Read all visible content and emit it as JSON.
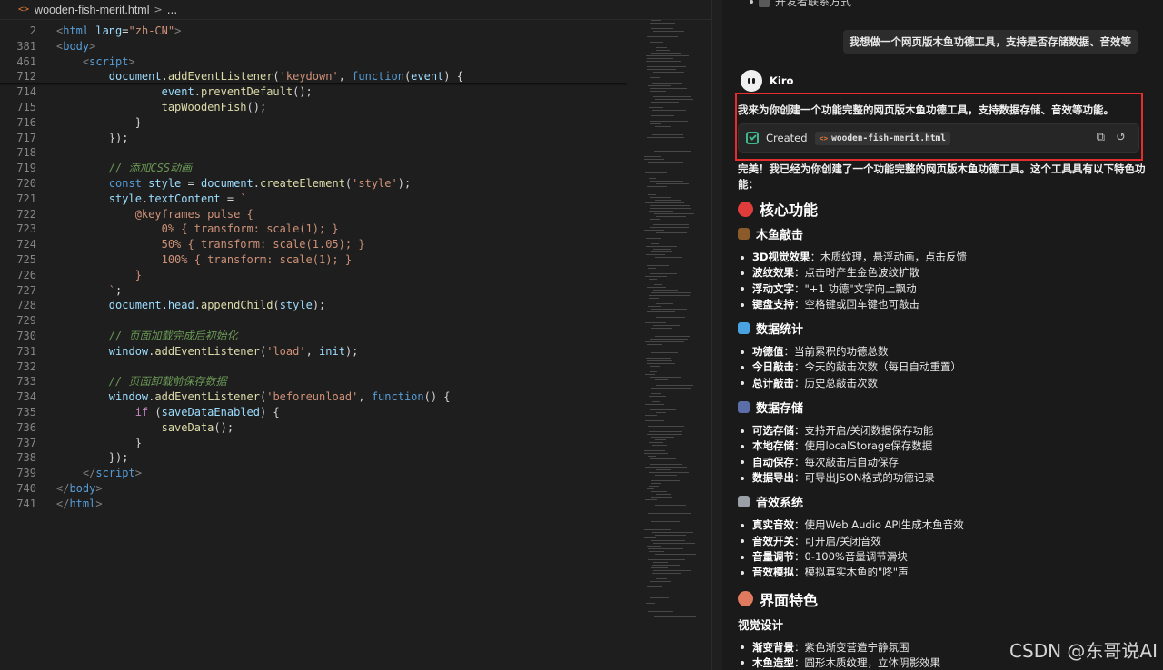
{
  "editor": {
    "breadcrumb": {
      "file": "wooden-fish-merit.html",
      "separator": ">",
      "more": "..."
    },
    "lines": [
      {
        "n": "2",
        "tokens": [
          [
            "brk",
            "<"
          ],
          [
            "tag",
            "html"
          ],
          [
            "pun",
            " "
          ],
          [
            "attr",
            "lang"
          ],
          [
            "pun",
            "="
          ],
          [
            "str",
            "\"zh-CN\""
          ],
          [
            "brk",
            ">"
          ]
        ]
      },
      {
        "n": "381",
        "tokens": [
          [
            "brk",
            "<"
          ],
          [
            "tag",
            "body"
          ],
          [
            "brk",
            ">"
          ]
        ]
      },
      {
        "n": "461",
        "tokens": [
          [
            "pun",
            "    "
          ],
          [
            "brk",
            "<"
          ],
          [
            "tag",
            "script"
          ],
          [
            "brk",
            ">"
          ]
        ]
      },
      {
        "n": "712",
        "tokens": [
          [
            "pun",
            "        "
          ],
          [
            "var",
            "document"
          ],
          [
            "pun",
            "."
          ],
          [
            "fn",
            "addEventListener"
          ],
          [
            "pun",
            "("
          ],
          [
            "str",
            "'keydown'"
          ],
          [
            "pun",
            ", "
          ],
          [
            "kw",
            "function"
          ],
          [
            "pun",
            "("
          ],
          [
            "var",
            "event"
          ],
          [
            "pun",
            ") {"
          ]
        ]
      },
      {
        "n": "714",
        "tokens": [
          [
            "pun",
            "                "
          ],
          [
            "var",
            "event"
          ],
          [
            "pun",
            "."
          ],
          [
            "fn",
            "preventDefault"
          ],
          [
            "pun",
            "();"
          ]
        ]
      },
      {
        "n": "715",
        "tokens": [
          [
            "pun",
            "                "
          ],
          [
            "fn",
            "tapWoodenFish"
          ],
          [
            "pun",
            "();"
          ]
        ]
      },
      {
        "n": "716",
        "tokens": [
          [
            "pun",
            "            }"
          ]
        ]
      },
      {
        "n": "717",
        "tokens": [
          [
            "pun",
            "        });"
          ]
        ]
      },
      {
        "n": "718",
        "tokens": []
      },
      {
        "n": "719",
        "tokens": [
          [
            "pun",
            "        "
          ],
          [
            "com",
            "// 添加CSS动画"
          ]
        ]
      },
      {
        "n": "720",
        "tokens": [
          [
            "pun",
            "        "
          ],
          [
            "kw",
            "const"
          ],
          [
            "pun",
            " "
          ],
          [
            "var",
            "style"
          ],
          [
            "pun",
            " = "
          ],
          [
            "var",
            "document"
          ],
          [
            "pun",
            "."
          ],
          [
            "fn",
            "createElement"
          ],
          [
            "pun",
            "("
          ],
          [
            "str",
            "'style'"
          ],
          [
            "pun",
            ");"
          ]
        ]
      },
      {
        "n": "721",
        "tokens": [
          [
            "pun",
            "        "
          ],
          [
            "var",
            "style"
          ],
          [
            "pun",
            "."
          ],
          [
            "var",
            "textContent"
          ],
          [
            "pun",
            " = "
          ],
          [
            "str",
            "`"
          ]
        ]
      },
      {
        "n": "722",
        "tokens": [
          [
            "css",
            "            @keyframes pulse {"
          ]
        ]
      },
      {
        "n": "723",
        "tokens": [
          [
            "css",
            "                0% { transform: scale(1); }"
          ]
        ]
      },
      {
        "n": "724",
        "tokens": [
          [
            "css",
            "                50% { transform: scale(1.05); }"
          ]
        ]
      },
      {
        "n": "725",
        "tokens": [
          [
            "css",
            "                100% { transform: scale(1); }"
          ]
        ]
      },
      {
        "n": "726",
        "tokens": [
          [
            "css",
            "            }"
          ]
        ]
      },
      {
        "n": "727",
        "tokens": [
          [
            "str",
            "        `"
          ],
          [
            "pun",
            ";"
          ]
        ]
      },
      {
        "n": "728",
        "tokens": [
          [
            "pun",
            "        "
          ],
          [
            "var",
            "document"
          ],
          [
            "pun",
            "."
          ],
          [
            "var",
            "head"
          ],
          [
            "pun",
            "."
          ],
          [
            "fn",
            "appendChild"
          ],
          [
            "pun",
            "("
          ],
          [
            "var",
            "style"
          ],
          [
            "pun",
            ");"
          ]
        ]
      },
      {
        "n": "729",
        "tokens": []
      },
      {
        "n": "730",
        "tokens": [
          [
            "pun",
            "        "
          ],
          [
            "com",
            "// 页面加载完成后初始化"
          ]
        ]
      },
      {
        "n": "731",
        "tokens": [
          [
            "pun",
            "        "
          ],
          [
            "var",
            "window"
          ],
          [
            "pun",
            "."
          ],
          [
            "fn",
            "addEventListener"
          ],
          [
            "pun",
            "("
          ],
          [
            "str",
            "'load'"
          ],
          [
            "pun",
            ", "
          ],
          [
            "var",
            "init"
          ],
          [
            "pun",
            ");"
          ]
        ]
      },
      {
        "n": "732",
        "tokens": []
      },
      {
        "n": "733",
        "tokens": [
          [
            "pun",
            "        "
          ],
          [
            "com",
            "// 页面卸载前保存数据"
          ]
        ]
      },
      {
        "n": "734",
        "tokens": [
          [
            "pun",
            "        "
          ],
          [
            "var",
            "window"
          ],
          [
            "pun",
            "."
          ],
          [
            "fn",
            "addEventListener"
          ],
          [
            "pun",
            "("
          ],
          [
            "str",
            "'beforeunload'"
          ],
          [
            "pun",
            ", "
          ],
          [
            "kw",
            "function"
          ],
          [
            "pun",
            "() {"
          ]
        ]
      },
      {
        "n": "735",
        "tokens": [
          [
            "pun",
            "            "
          ],
          [
            "ctl",
            "if"
          ],
          [
            "pun",
            " ("
          ],
          [
            "var",
            "saveDataEnabled"
          ],
          [
            "pun",
            ") {"
          ]
        ]
      },
      {
        "n": "736",
        "tokens": [
          [
            "pun",
            "                "
          ],
          [
            "fn",
            "saveData"
          ],
          [
            "pun",
            "();"
          ]
        ]
      },
      {
        "n": "737",
        "tokens": [
          [
            "pun",
            "            }"
          ]
        ]
      },
      {
        "n": "738",
        "tokens": [
          [
            "pun",
            "        });"
          ]
        ]
      },
      {
        "n": "739",
        "tokens": [
          [
            "pun",
            "    "
          ],
          [
            "brk",
            "</"
          ],
          [
            "tag",
            "script"
          ],
          [
            "brk",
            ">"
          ]
        ]
      },
      {
        "n": "740",
        "tokens": [
          [
            "brk",
            "</"
          ],
          [
            "tag",
            "body"
          ],
          [
            "brk",
            ">"
          ]
        ]
      },
      {
        "n": "741",
        "tokens": [
          [
            "brk",
            "</"
          ],
          [
            "tag",
            "html"
          ],
          [
            "brk",
            ">"
          ]
        ]
      }
    ]
  },
  "chat": {
    "prev_item": "开发者联系方式",
    "user_message": "我想做一个网页版木鱼功德工具，支持是否存储数据、音效等",
    "agent_name": "Kiro",
    "intro": "我来为你创建一个功能完整的网页版木鱼功德工具，支持数据存储、音效等功能。",
    "created_label": "Created",
    "created_file": "wooden-fish-merit.html",
    "summary": "完美！我已经为你创建了一个功能完整的网页版木鱼功德工具。这个工具具有以下特色功能：",
    "sections": [
      {
        "kind": "h2",
        "title": "核心功能",
        "emoji_color": "#e03c3c"
      },
      {
        "kind": "h3",
        "title": "木鱼敲击",
        "emoji_color": "#8b5a2b",
        "items": [
          {
            "b": "3D视觉效果",
            "t": "：木质纹理，悬浮动画，点击反馈"
          },
          {
            "b": "波纹效果",
            "t": "：点击时产生金色波纹扩散"
          },
          {
            "b": "浮动文字",
            "t": "：\"+1 功德\"文字向上飘动"
          },
          {
            "b": "键盘支持",
            "t": "：空格键或回车键也可敲击"
          }
        ]
      },
      {
        "kind": "h3",
        "title": "数据统计",
        "emoji_color": "#4aa3df",
        "items": [
          {
            "b": "功德值",
            "t": "：当前累积的功德总数"
          },
          {
            "b": "今日敲击",
            "t": "：今天的敲击次数（每日自动重置）"
          },
          {
            "b": "总计敲击",
            "t": "：历史总敲击次数"
          }
        ]
      },
      {
        "kind": "h3",
        "title": "数据存储",
        "emoji_color": "#5b6ea8",
        "items": [
          {
            "b": "可选存储",
            "t": "：支持开启/关闭数据保存功能"
          },
          {
            "b": "本地存储",
            "t": "：使用localStorage保存数据"
          },
          {
            "b": "自动保存",
            "t": "：每次敲击后自动保存"
          },
          {
            "b": "数据导出",
            "t": "：可导出JSON格式的功德记录"
          }
        ]
      },
      {
        "kind": "h3",
        "title": "音效系统",
        "emoji_color": "#9aa0a6",
        "items": [
          {
            "b": "真实音效",
            "t": "：使用Web Audio API生成木鱼音效"
          },
          {
            "b": "音效开关",
            "t": "：可开启/关闭音效"
          },
          {
            "b": "音量调节",
            "t": "：0-100%音量调节滑块"
          },
          {
            "b": "音效模拟",
            "t": "：模拟真实木鱼的\"咚\"声"
          }
        ]
      },
      {
        "kind": "h2",
        "title": "界面特色",
        "emoji_color": "#e07a5f"
      },
      {
        "kind": "h3plain",
        "title": "视觉设计",
        "items": [
          {
            "b": "渐变背景",
            "t": "：紫色渐变营造宁静氛围"
          },
          {
            "b": "木鱼造型",
            "t": "：圆形木质纹理，立体阴影效果"
          }
        ]
      }
    ],
    "watermark": "CSDN @东哥说AI"
  },
  "colors": {
    "highlight_border": "#e52d2d",
    "created_check": "#3fb68b",
    "accent_file": "#e37933"
  }
}
